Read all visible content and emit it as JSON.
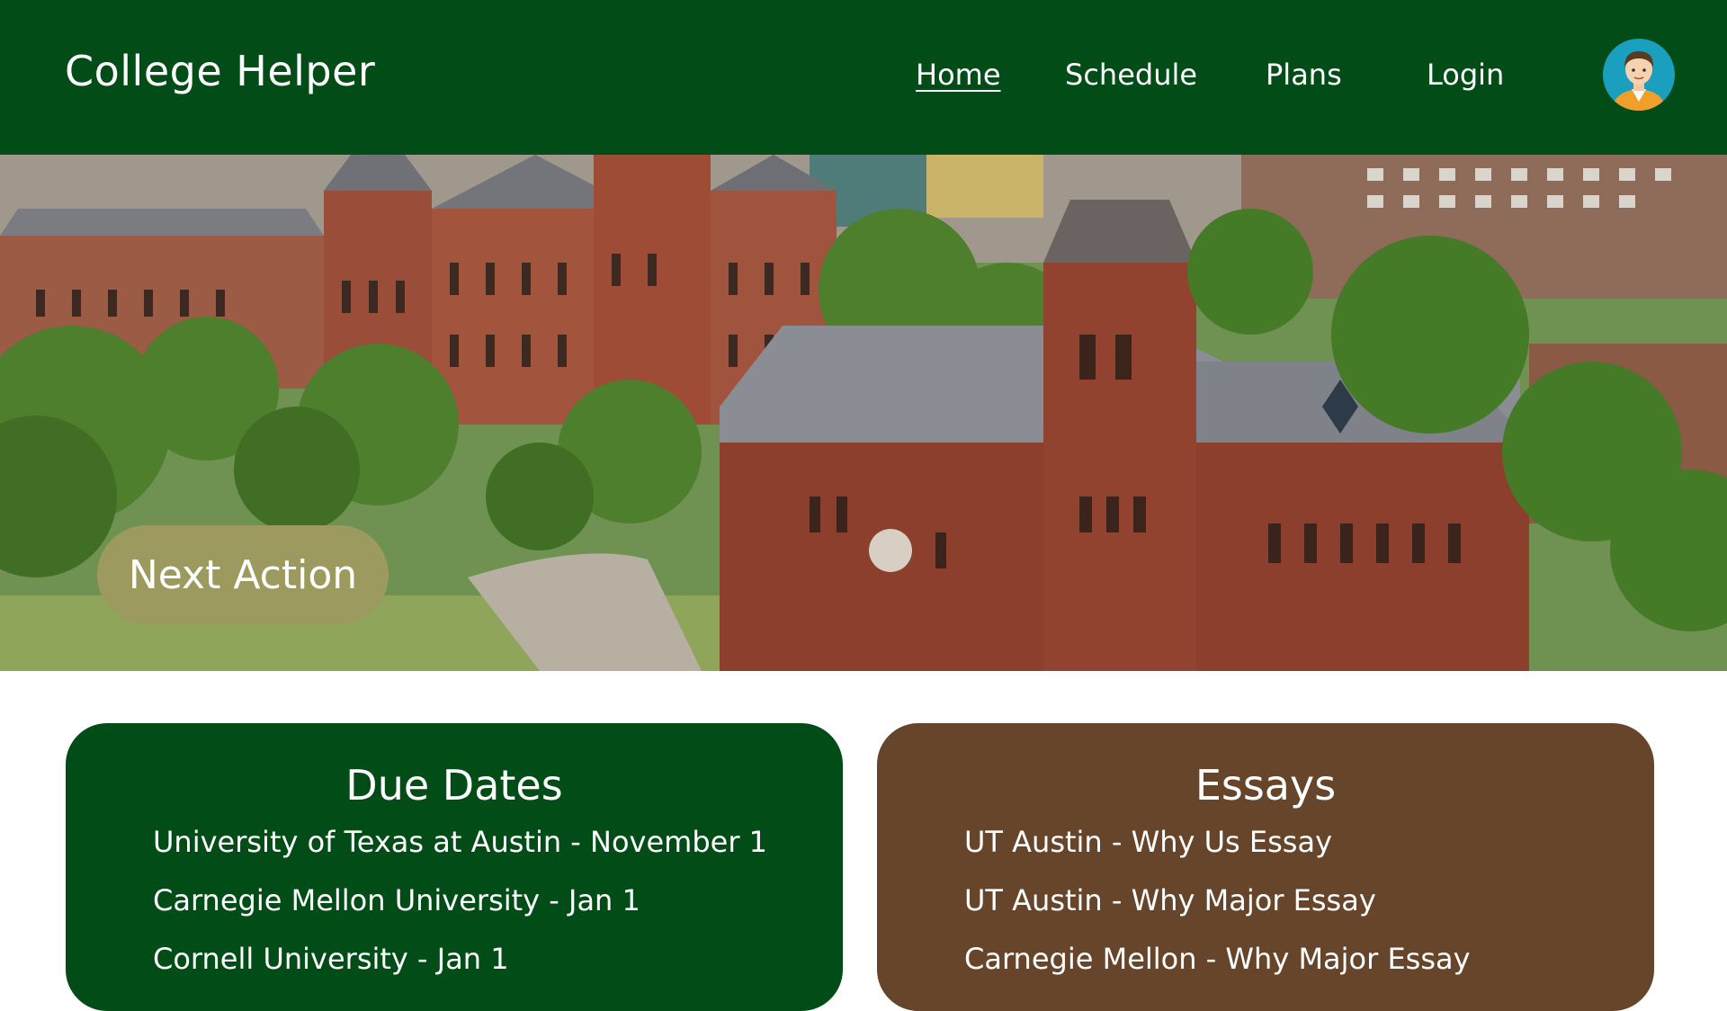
{
  "app": {
    "title": "College Helper"
  },
  "nav": {
    "items": [
      {
        "label": "Home",
        "active": true
      },
      {
        "label": "Schedule",
        "active": false
      },
      {
        "label": "Plans",
        "active": false
      },
      {
        "label": "Login",
        "active": false
      }
    ]
  },
  "hero": {
    "action_label": "Next Action"
  },
  "due_dates": {
    "title": "Due Dates",
    "items": [
      "University of Texas at Austin - November 1",
      "Carnegie Mellon University - Jan 1",
      "Cornell University - Jan 1"
    ]
  },
  "essays": {
    "title": "Essays",
    "items": [
      "UT Austin - Why Us Essay",
      "UT Austin - Why Major Essay",
      "Carnegie Mellon - Why Major Essay"
    ]
  },
  "colors": {
    "header_green": "#024d17",
    "card_brown": "#67452a",
    "action_olive": "#9c9a5e"
  },
  "icons": {
    "avatar": "user-avatar-icon"
  }
}
